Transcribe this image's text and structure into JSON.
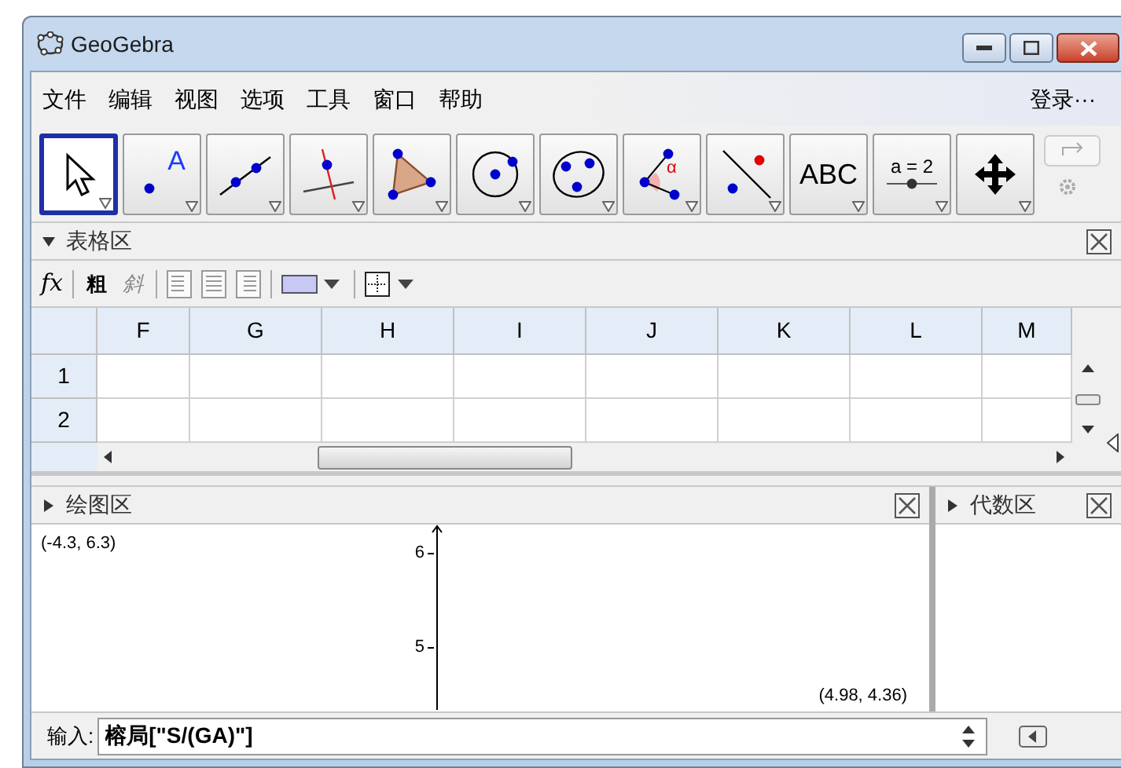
{
  "window": {
    "title": "GeoGebra"
  },
  "menu": [
    "文件",
    "编辑",
    "视图",
    "选项",
    "工具",
    "窗口",
    "帮助"
  ],
  "login": "登录···",
  "tools": [
    {
      "kind": "move",
      "selected": true
    },
    {
      "kind": "point",
      "selected": false,
      "label": "A"
    },
    {
      "kind": "line",
      "selected": false
    },
    {
      "kind": "perpendicular",
      "selected": false
    },
    {
      "kind": "polygon",
      "selected": false
    },
    {
      "kind": "circle",
      "selected": false
    },
    {
      "kind": "conic",
      "selected": false
    },
    {
      "kind": "angle",
      "selected": false,
      "label": "α"
    },
    {
      "kind": "reflect",
      "selected": false
    },
    {
      "kind": "text",
      "selected": false,
      "label": "ABC"
    },
    {
      "kind": "slider",
      "selected": false,
      "label": "a = 2"
    },
    {
      "kind": "pan",
      "selected": false
    }
  ],
  "spreadsheet": {
    "title": "表格区",
    "expanded": true,
    "formula_label": "fx",
    "bold": "粗",
    "italic": "斜",
    "columns": [
      "F",
      "G",
      "H",
      "I",
      "J",
      "K",
      "L",
      "M"
    ],
    "rows": [
      "1",
      "2"
    ]
  },
  "graphics": {
    "title": "绘图区",
    "expanded": false,
    "top_left": "(-4.3, 6.3)",
    "bottom_right": "(4.98, 4.36)",
    "y_ticks": [
      "6",
      "5"
    ]
  },
  "algebra": {
    "title": "代数区",
    "expanded": false
  },
  "input_bar": {
    "label": "输入:",
    "value": "榕局[\"S/(GA)\"]"
  }
}
